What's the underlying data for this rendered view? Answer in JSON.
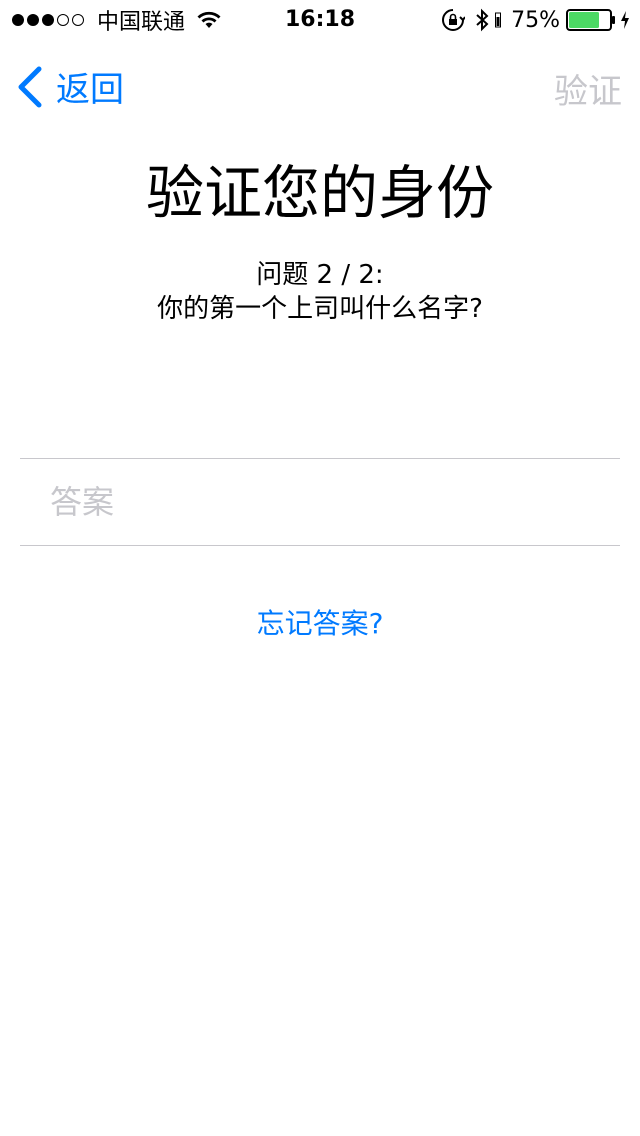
{
  "status_bar": {
    "signal_full": 3,
    "signal_total": 5,
    "carrier": "中国联通",
    "time": "16:18",
    "battery_percent": "75%",
    "battery_level": 0.75,
    "battery_color": "#4cd964",
    "icons": [
      "wifi-icon",
      "rotation-lock-icon",
      "bluetooth-icon",
      "battery-icon",
      "charging-icon"
    ]
  },
  "nav": {
    "back_label": "返回",
    "verify_label": "验证",
    "accent_color": "#007aff",
    "disabled_color": "#c7c7cc"
  },
  "main": {
    "title": "验证您的身份",
    "question_number": "问题 2 / 2:",
    "question_text": "你的第一个上司叫什么名字?",
    "answer_placeholder": "答案",
    "answer_value": "",
    "forgot_link": "忘记答案?"
  }
}
